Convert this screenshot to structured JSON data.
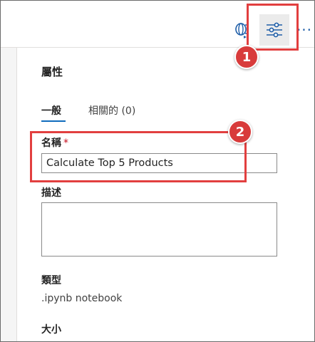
{
  "toolbar": {
    "run_icon": "notebook-run-icon",
    "properties_icon": "settings-sliders-icon",
    "more_label": "···"
  },
  "callouts": [
    "1",
    "2"
  ],
  "panel": {
    "title": "屬性",
    "tabs": [
      {
        "label": "一般",
        "active": true
      },
      {
        "label": "相關的 (0)",
        "active": false
      }
    ],
    "fields": {
      "name_label": "名稱",
      "name_required": "*",
      "name_value": "Calculate Top 5 Products",
      "description_label": "描述",
      "description_value": "",
      "type_label": "類型",
      "type_value": ".ipynb notebook",
      "size_label": "大小"
    }
  },
  "colors": {
    "callout": "#e23f3f",
    "badge": "#d83b3b",
    "accent": "#0f6cbd",
    "required": "#c50f1f"
  }
}
